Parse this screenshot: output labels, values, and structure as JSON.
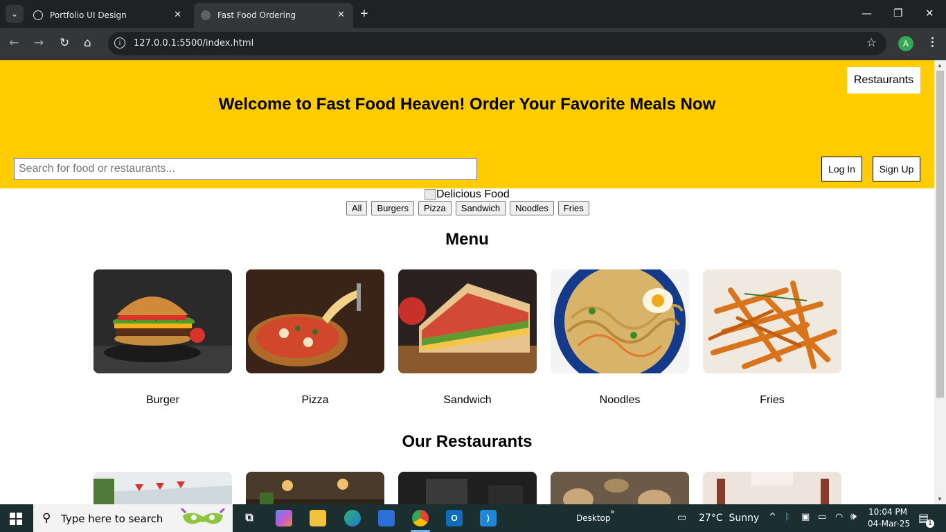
{
  "browser": {
    "tabs": [
      {
        "title": "Portfolio UI Design",
        "active": false
      },
      {
        "title": "Fast Food Ordering",
        "active": true
      }
    ],
    "url": "127.0.0.1:5500/index.html",
    "profile_initial": "A"
  },
  "page": {
    "header": {
      "restaurants_link": "Restaurants",
      "welcome": "Welcome to Fast Food Heaven! Order Your Favorite Meals Now",
      "search_placeholder": "Search for food or restaurants...",
      "login_label": "Log In",
      "signup_label": "Sign Up",
      "bg_color": "#ffcc00"
    },
    "hero_alt": "Delicious Food",
    "filters": [
      "All",
      "Burgers",
      "Pizza",
      "Sandwich",
      "Noodles",
      "Fries"
    ],
    "menu_title": "Menu",
    "menu_items": [
      {
        "name": "Burger"
      },
      {
        "name": "Pizza"
      },
      {
        "name": "Sandwich"
      },
      {
        "name": "Noodles"
      },
      {
        "name": "Fries"
      }
    ],
    "restaurants_title": "Our Restaurants"
  },
  "taskbar": {
    "search_placeholder": "Type here to search",
    "desktop_label": "Desktop",
    "weather": "27°C  Sunny",
    "time": "10:04 PM",
    "date": "04-Mar-25",
    "notification_count": "1"
  }
}
